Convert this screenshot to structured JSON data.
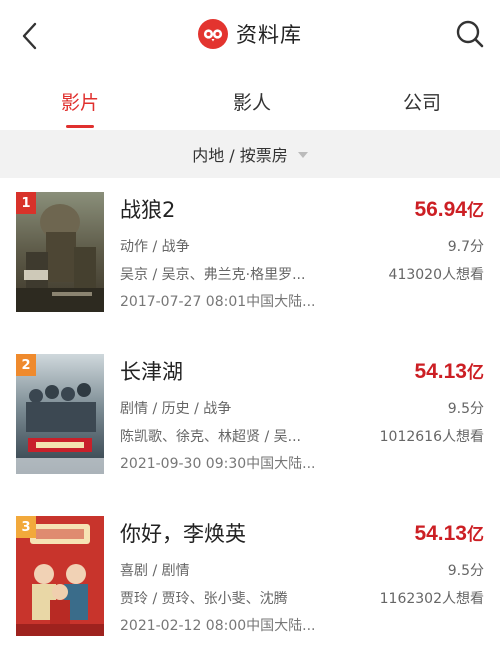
{
  "header": {
    "title": "资料库",
    "back_icon": "chevron-left-icon",
    "search_icon": "search-icon",
    "logo_icon": "owl-logo-icon",
    "brand_color": "#e3342f"
  },
  "tabs": [
    {
      "label": "影片",
      "active": true
    },
    {
      "label": "影人",
      "active": false
    },
    {
      "label": "公司",
      "active": false
    }
  ],
  "filter": {
    "label": "内地 / 按票房"
  },
  "accent_color": "#cc1f24",
  "movies": [
    {
      "rank": "1",
      "rank_color": "#d8322a",
      "name": "战狼2",
      "box_office_value": "56.94",
      "box_office_unit": "亿",
      "genre": "动作 / 战争",
      "score": "9.7分",
      "cast": "吴京 / 吴京、弗兰克·格里罗...",
      "want": "413020人想看",
      "release": "2017-07-27 08:01中国大陆..."
    },
    {
      "rank": "2",
      "rank_color": "#ef8a2d",
      "name": "长津湖",
      "box_office_value": "54.13",
      "box_office_unit": "亿",
      "genre": "剧情 / 历史 / 战争",
      "score": "9.5分",
      "cast": "陈凯歌、徐克、林超贤 / 吴...",
      "want": "1012616人想看",
      "release": "2021-09-30 09:30中国大陆..."
    },
    {
      "rank": "3",
      "rank_color": "#f2a93b",
      "name": "你好，李焕英",
      "box_office_value": "54.13",
      "box_office_unit": "亿",
      "genre": "喜剧 / 剧情",
      "score": "9.5分",
      "cast": "贾玲 / 贾玲、张小斐、沈腾",
      "want": "1162302人想看",
      "release": "2021-02-12 08:00中国大陆..."
    }
  ]
}
